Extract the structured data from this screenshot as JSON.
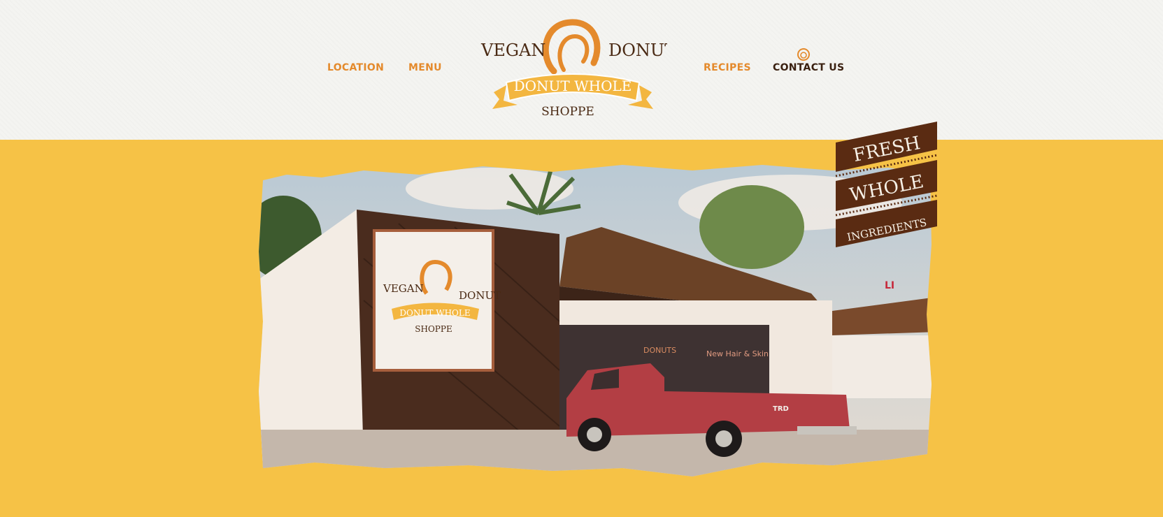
{
  "nav": {
    "location": "LOCATION",
    "menu": "MENU",
    "recipes": "RECIPES",
    "contact": "CONTACT US"
  },
  "logo": {
    "word_left": "VEGAN",
    "word_right": "DONUT",
    "banner": "DONUT WHOLE",
    "bottom": "SHOPPE"
  },
  "badge": {
    "line1": "FRESH",
    "line2": "WHOLE",
    "line3": "INGREDIENTS"
  },
  "storefront": {
    "sign_word_left": "VEGAN",
    "sign_word_right": "DONUT",
    "sign_banner": "DONUT WHOLE",
    "sign_bottom": "SHOPPE",
    "window_text": "DONUTS",
    "window_text_2": "New Hair & Skin",
    "truck_badge": "TRD",
    "corner_sign": "LI"
  },
  "colors": {
    "brand_orange": "#e48a2c",
    "brand_brown": "#4a2a14",
    "hero_yellow": "#f6c246",
    "banner_yellow": "#f3b640"
  }
}
